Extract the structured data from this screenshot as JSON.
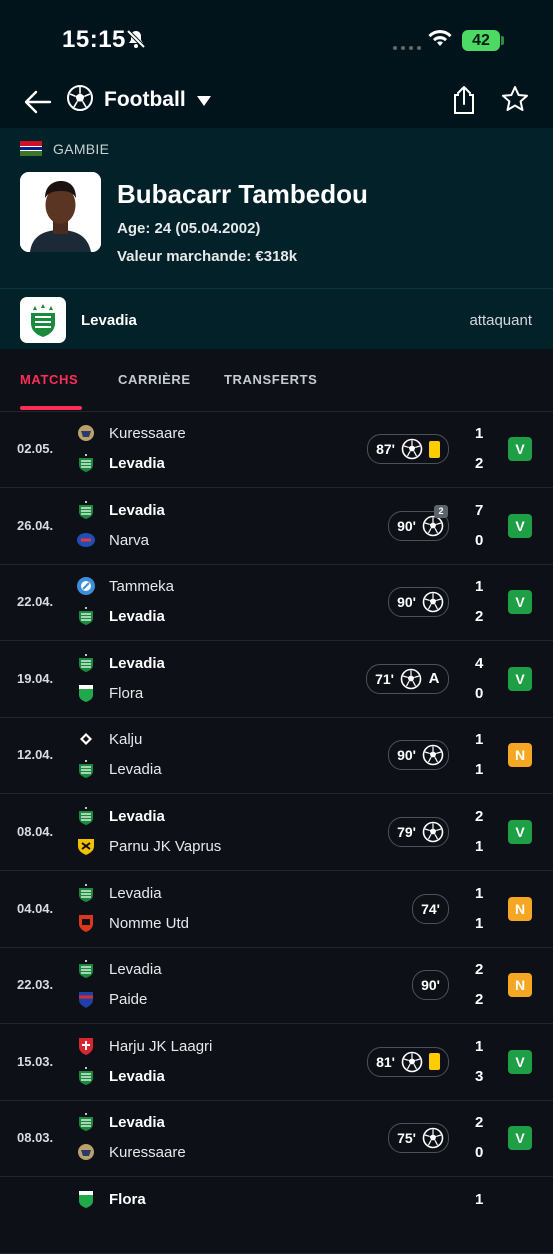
{
  "status_bar": {
    "time": "15:15",
    "battery": "42"
  },
  "nav": {
    "sport": "Football"
  },
  "player": {
    "country": "GAMBIE",
    "name": "Bubacarr Tambedou",
    "age": "Age: 24 (05.04.2002)",
    "market_value": "Valeur marchande: €318k",
    "team": "Levadia",
    "position": "attaquant"
  },
  "tabs": [
    {
      "label": "MATCHS",
      "active": true
    },
    {
      "label": "CARRIÈRE",
      "active": false
    },
    {
      "label": "TRANSFERTS",
      "active": false
    }
  ],
  "colors": {
    "accent": "#ff2d55",
    "win": "#1e9e45",
    "draw": "#f5a623",
    "yellow_card": "#ffcc00"
  },
  "matches": [
    {
      "date": "02.05.",
      "home": "Kuressaare",
      "away": "Levadia",
      "home_score": "1",
      "away_score": "2",
      "minutes": "87'",
      "goals": 1,
      "goal_count_badge": "",
      "yellow_card": true,
      "assist": "",
      "result": "V",
      "bold": "away",
      "home_icon": "kuressaare-logo-icon",
      "away_icon": "levadia-logo-icon"
    },
    {
      "date": "26.04.",
      "home": "Levadia",
      "away": "Narva",
      "home_score": "7",
      "away_score": "0",
      "minutes": "90'",
      "goals": 1,
      "goal_count_badge": "2",
      "yellow_card": false,
      "assist": "",
      "result": "V",
      "bold": "home",
      "home_icon": "levadia-logo-icon",
      "away_icon": "narva-logo-icon"
    },
    {
      "date": "22.04.",
      "home": "Tammeka",
      "away": "Levadia",
      "home_score": "1",
      "away_score": "2",
      "minutes": "90'",
      "goals": 1,
      "goal_count_badge": "",
      "yellow_card": false,
      "assist": "",
      "result": "V",
      "bold": "away",
      "home_icon": "tammeka-logo-icon",
      "away_icon": "levadia-logo-icon"
    },
    {
      "date": "19.04.",
      "home": "Levadia",
      "away": "Flora",
      "home_score": "4",
      "away_score": "0",
      "minutes": "71'",
      "goals": 1,
      "goal_count_badge": "",
      "yellow_card": false,
      "assist": "A",
      "result": "V",
      "bold": "home",
      "home_icon": "levadia-logo-icon",
      "away_icon": "flora-logo-icon"
    },
    {
      "date": "12.04.",
      "home": "Kalju",
      "away": "Levadia",
      "home_score": "1",
      "away_score": "1",
      "minutes": "90'",
      "goals": 1,
      "goal_count_badge": "",
      "yellow_card": false,
      "assist": "",
      "result": "N",
      "bold": "",
      "home_icon": "kalju-logo-icon",
      "away_icon": "levadia-logo-icon"
    },
    {
      "date": "08.04.",
      "home": "Levadia",
      "away": "Parnu JK Vaprus",
      "home_score": "2",
      "away_score": "1",
      "minutes": "79'",
      "goals": 1,
      "goal_count_badge": "",
      "yellow_card": false,
      "assist": "",
      "result": "V",
      "bold": "home",
      "home_icon": "levadia-logo-icon",
      "away_icon": "vaprus-logo-icon"
    },
    {
      "date": "04.04.",
      "home": "Levadia",
      "away": "Nomme Utd",
      "home_score": "1",
      "away_score": "1",
      "minutes": "74'",
      "goals": 0,
      "goal_count_badge": "",
      "yellow_card": false,
      "assist": "",
      "result": "N",
      "bold": "",
      "home_icon": "levadia-logo-icon",
      "away_icon": "nomme-logo-icon"
    },
    {
      "date": "22.03.",
      "home": "Levadia",
      "away": "Paide",
      "home_score": "2",
      "away_score": "2",
      "minutes": "90'",
      "goals": 0,
      "goal_count_badge": "",
      "yellow_card": false,
      "assist": "",
      "result": "N",
      "bold": "",
      "home_icon": "levadia-logo-icon",
      "away_icon": "paide-logo-icon"
    },
    {
      "date": "15.03.",
      "home": "Harju JK Laagri",
      "away": "Levadia",
      "home_score": "1",
      "away_score": "3",
      "minutes": "81'",
      "goals": 1,
      "goal_count_badge": "",
      "yellow_card": true,
      "assist": "",
      "result": "V",
      "bold": "away",
      "home_icon": "harju-logo-icon",
      "away_icon": "levadia-logo-icon"
    },
    {
      "date": "08.03.",
      "home": "Levadia",
      "away": "Kuressaare",
      "home_score": "2",
      "away_score": "0",
      "minutes": "75'",
      "goals": 1,
      "goal_count_badge": "",
      "yellow_card": false,
      "assist": "",
      "result": "V",
      "bold": "home",
      "home_icon": "levadia-logo-icon",
      "away_icon": "kuressaare-logo-icon"
    },
    {
      "date": "",
      "home": "Flora",
      "away": "",
      "home_score": "1",
      "away_score": "",
      "minutes": "",
      "goals": 0,
      "goal_count_badge": "",
      "yellow_card": false,
      "assist": "",
      "result": "",
      "bold": "home",
      "home_icon": "flora-logo-icon",
      "away_icon": ""
    }
  ]
}
